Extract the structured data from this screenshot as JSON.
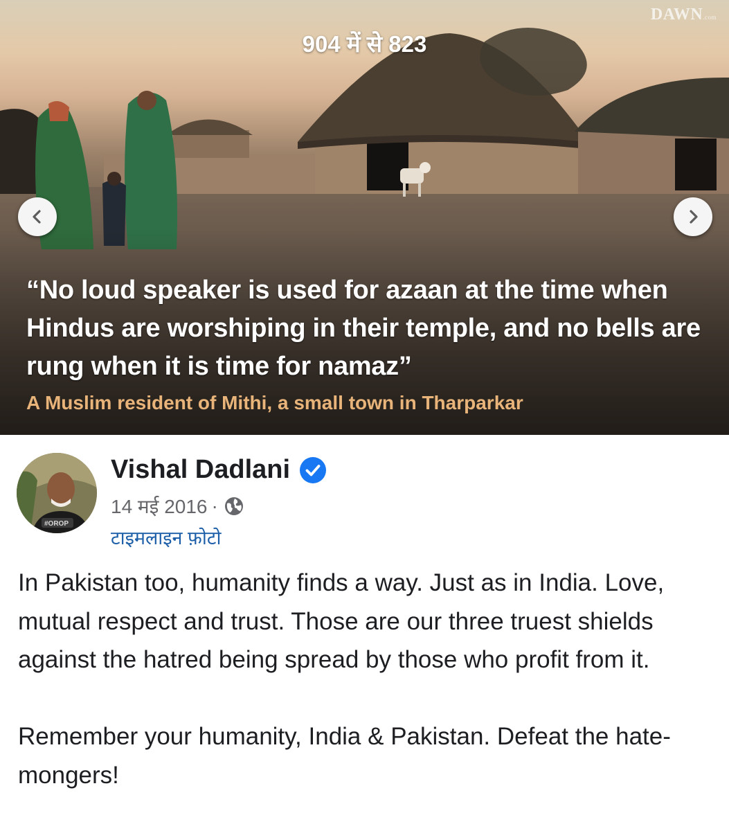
{
  "viewer": {
    "counter": "904 में से 823",
    "watermark": "DAWN",
    "watermark_suffix": ".com",
    "prev_icon": "chevron-left-icon",
    "next_icon": "chevron-right-icon"
  },
  "photo": {
    "quote_lines": [
      "“No loud speaker is used for azaan at the time when",
      "Hindus are worshiping in their temple, and no bells are",
      "rung when it is time for namaz”"
    ],
    "attribution": "A Muslim resident of Mithi, a small town in Tharparkar"
  },
  "post": {
    "author": "Vishal Dadlani",
    "verified_icon": "verified-badge-icon",
    "date": "14 मई 2016",
    "separator": "·",
    "privacy_icon": "globe-icon",
    "album": "टाइमलाइन फ़ोटो",
    "avatar_badge": "#OROP",
    "paragraphs": [
      "In Pakistan too, humanity finds a way. Just as in India. Love, mutual respect and trust. Those are our three truest shields against the hatred being spread by those who profit from it.",
      "Remember your humanity, India & Pakistan. Defeat the hate-mongers!"
    ]
  },
  "colors": {
    "accent_link": "#1c5fa8",
    "verified": "#1877f2",
    "attribution": "#e9b47a",
    "text": "#1c1e21",
    "muted": "#65676b"
  }
}
